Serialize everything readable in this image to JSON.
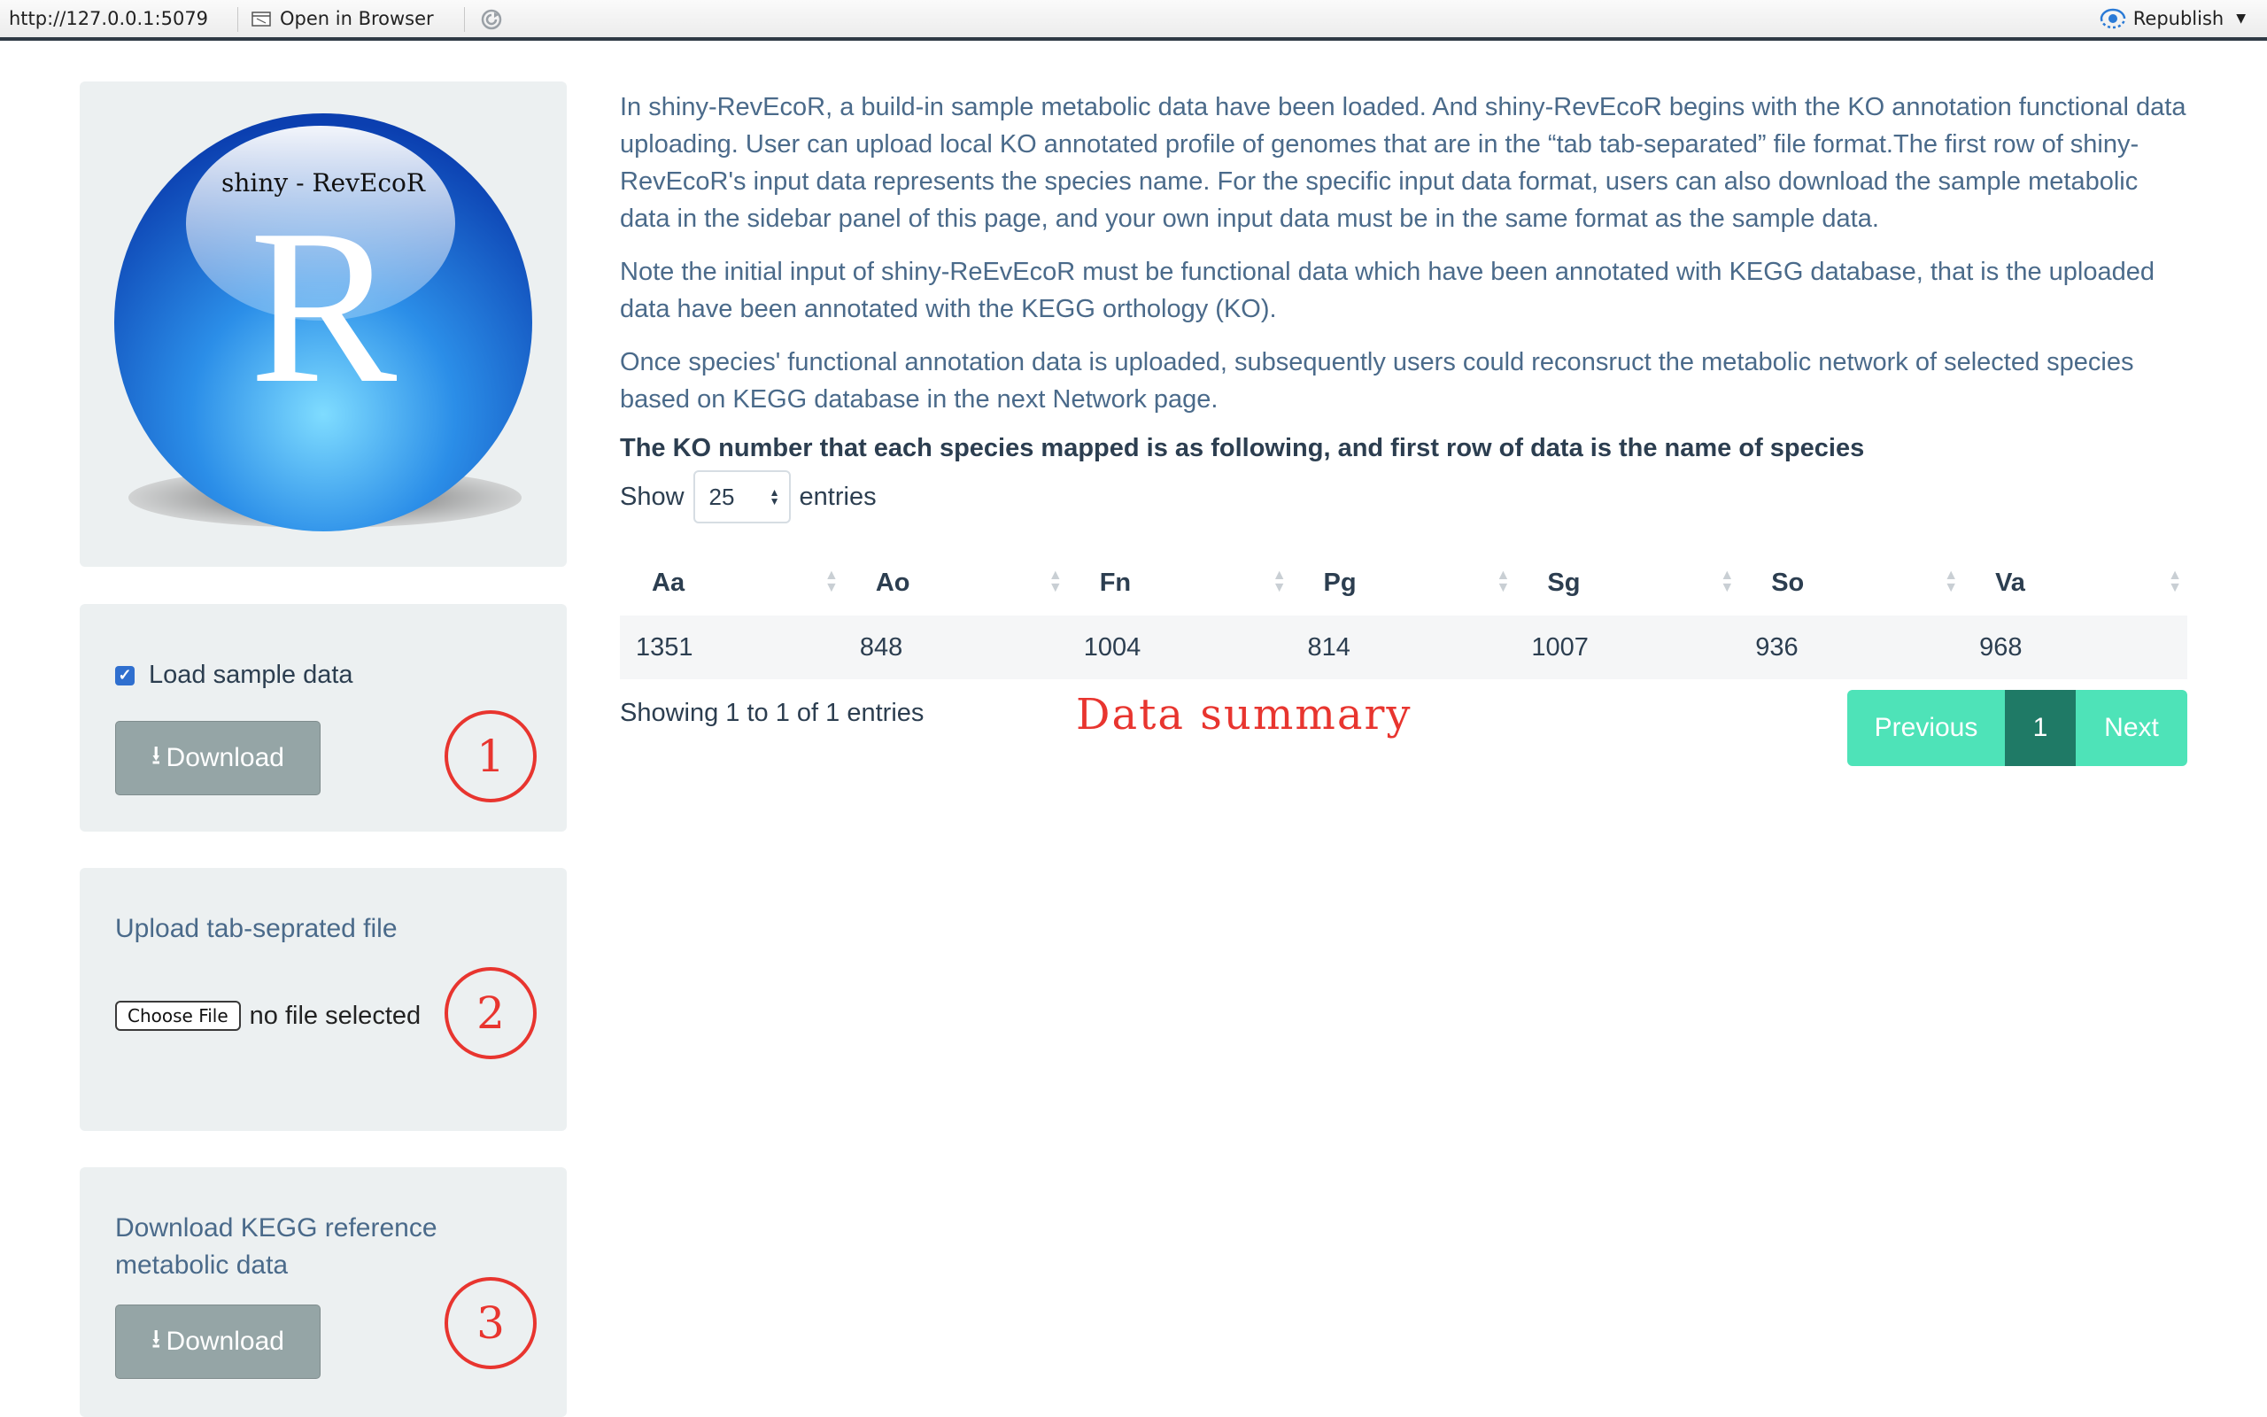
{
  "toolbar": {
    "url": "http://127.0.0.1:5079",
    "open_in_browser": "Open in Browser",
    "republish": "Republish"
  },
  "logo": {
    "caption": "shiny - RevEcoR",
    "letter": "R"
  },
  "panel1": {
    "checkbox_label": "Load sample data",
    "checkbox_checked": true,
    "download_label": "Download",
    "step_number": "1"
  },
  "panel2": {
    "upload_label": "Upload tab-seprated file",
    "choose_file": "Choose File",
    "file_status": "no file selected",
    "step_number": "2"
  },
  "panel3": {
    "label": "Download KEGG reference metabolic data",
    "download_label": "Download",
    "step_number": "3"
  },
  "intro": {
    "p1": "In shiny-RevEcoR, a build-in sample metabolic data have been loaded. And shiny-RevEcoR begins with the KO annotation functional data uploading. User can upload local KO annotated profile of genomes that are in the “tab tab-separated” file format.The first row of shiny-RevEcoR's input data represents the species name. For the specific input data format, users can also download the sample metabolic data in the sidebar panel of this page, and your own input data must be in the same format as the sample data.",
    "p2": "Note the initial input of shiny-ReEvEcoR must be functional data which have been annotated with KEGG database, that is the uploaded data have been annotated with the KEGG orthology (KO).",
    "p3": "Once species' functional annotation data is uploaded, subsequently users could reconsruct the metabolic network of selected species based on KEGG database in the next Network page."
  },
  "table": {
    "heading": "The KO number that each species mapped is as following, and first row of data is the name of species",
    "show_label": "Show",
    "length_value": "25",
    "entries_label": "entries",
    "columns": [
      "Aa",
      "Ao",
      "Fn",
      "Pg",
      "Sg",
      "So",
      "Va"
    ],
    "rows": [
      [
        "1351",
        "848",
        "1004",
        "814",
        "1007",
        "936",
        "968"
      ]
    ],
    "info": "Showing 1 to 1 of 1 entries",
    "annotation": "Data summary",
    "pager": {
      "previous": "Previous",
      "current": "1",
      "next": "Next"
    }
  },
  "colors": {
    "accent_teal": "#4ee3b8",
    "active_page": "#1f7a66",
    "annotation_red": "#e8352f",
    "text_blue": "#4a6a8a",
    "button_gray": "#95a5a6",
    "panel_bg": "#ecf0f1"
  }
}
